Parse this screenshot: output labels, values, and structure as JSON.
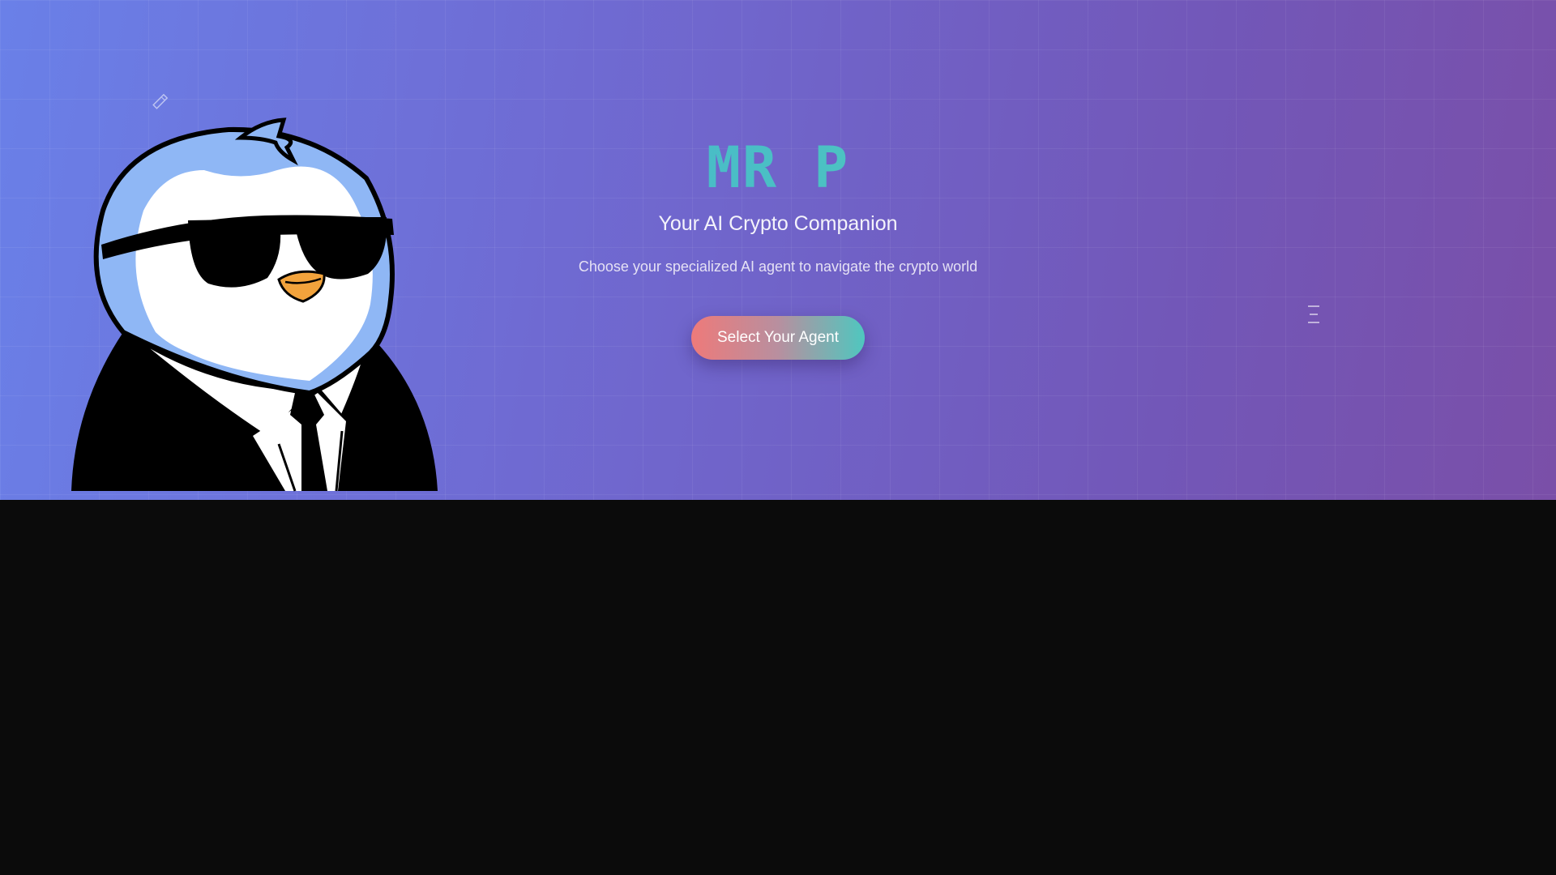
{
  "hero": {
    "title": "MR P",
    "subtitle": "Your AI Crypto Companion",
    "description": "Choose your specialized AI agent to navigate the crypto world",
    "cta_label": "Select Your Agent"
  },
  "mascot": {
    "icon": "penguin-in-suit-mascot"
  },
  "decorations": [
    {
      "icon": "pencil-icon"
    },
    {
      "icon": "lines-menu-icon"
    }
  ],
  "colors": {
    "gradient_start": "#6a80e8",
    "gradient_end": "#7a4fa8",
    "title": "#4fc1c9",
    "button_start": "#ee7a7a",
    "button_end": "#4fc7bf",
    "page_bottom": "#0b0b0b"
  }
}
